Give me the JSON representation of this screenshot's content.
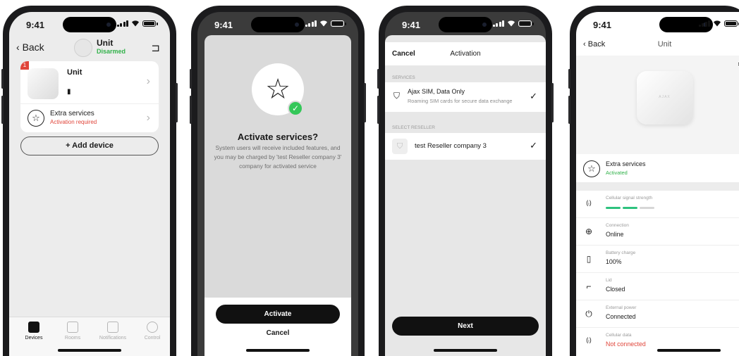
{
  "status": {
    "time": "9:41"
  },
  "phone1": {
    "back": "Back",
    "title": "Unit",
    "subtitle": "Disarmed",
    "device_badge": "1",
    "device_name": "Unit",
    "extra_title": "Extra services",
    "extra_subtitle": "Activation required",
    "add_device": "+ Add device",
    "tabs": [
      {
        "label": "Devices",
        "icon": "devices-icon"
      },
      {
        "label": "Rooms",
        "icon": "rooms-icon"
      },
      {
        "label": "Notifications",
        "icon": "notifications-icon"
      },
      {
        "label": "Control",
        "icon": "control-icon"
      }
    ]
  },
  "phone2": {
    "title": "Activate services?",
    "description": "System users will receive included features, and you may be charged by 'test Reseller company 3' company for activated service",
    "activate": "Activate",
    "cancel": "Cancel"
  },
  "phone3": {
    "cancel": "Cancel",
    "title": "Activation",
    "services_header": "SERVICES",
    "service_name": "Ajax SIM, Data Only",
    "service_desc": "Roaming SIM cards for secure data exchange",
    "reseller_header": "SELECT RESELLER",
    "reseller_name": "test Reseller company 3",
    "next": "Next"
  },
  "phone4": {
    "back": "Back",
    "title": "Unit",
    "hub_brand": "AJAX",
    "extra_title": "Extra services",
    "extra_subtitle": "Activated",
    "signal_label": "Cellular signal strength",
    "signal_level": 2,
    "signal_max": 3,
    "props": [
      {
        "label": "Connection",
        "value": "Online",
        "icon": "globe-icon",
        "status": "normal"
      },
      {
        "label": "Battery charge",
        "value": "100%",
        "icon": "battery-icon",
        "status": "normal"
      },
      {
        "label": "Lid",
        "value": "Closed",
        "icon": "lid-icon",
        "status": "normal"
      },
      {
        "label": "External power",
        "value": "Connected",
        "icon": "power-icon",
        "status": "normal"
      },
      {
        "label": "Cellular data",
        "value": "Not connected",
        "icon": "antenna-icon",
        "status": "error"
      }
    ]
  },
  "colors": {
    "accent_green": "#32b24a",
    "error_red": "#e0453a",
    "primary_button": "#111111"
  }
}
